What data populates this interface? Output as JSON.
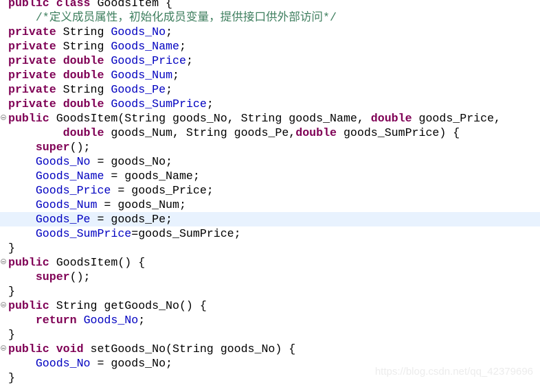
{
  "colors": {
    "keyword": "#7f0055",
    "field": "#0000c0",
    "comment": "#3f7f5f",
    "current_line": "#e8f2fe"
  },
  "highlighted_line": 15,
  "lines": [
    {
      "t": [
        [
          "k",
          "public"
        ],
        [
          "p",
          " "
        ],
        [
          "k",
          "class"
        ],
        [
          "p",
          " GoodsItem {"
        ]
      ]
    },
    {
      "t": [
        [
          "p",
          "    "
        ],
        [
          "c",
          "/*定义成员属性，初始化成员变量，提供接口供外部访问*/"
        ]
      ]
    },
    {
      "t": [
        [
          "k",
          "private"
        ],
        [
          "p",
          " String "
        ],
        [
          "f",
          "Goods_No"
        ],
        [
          "p",
          ";"
        ]
      ]
    },
    {
      "t": [
        [
          "k",
          "private"
        ],
        [
          "p",
          " String "
        ],
        [
          "f",
          "Goods_Name"
        ],
        [
          "p",
          ";"
        ]
      ]
    },
    {
      "t": [
        [
          "k",
          "private"
        ],
        [
          "p",
          " "
        ],
        [
          "k",
          "double"
        ],
        [
          "p",
          " "
        ],
        [
          "f",
          "Goods_Price"
        ],
        [
          "p",
          ";"
        ]
      ]
    },
    {
      "t": [
        [
          "k",
          "private"
        ],
        [
          "p",
          " "
        ],
        [
          "k",
          "double"
        ],
        [
          "p",
          " "
        ],
        [
          "f",
          "Goods_Num"
        ],
        [
          "p",
          ";"
        ]
      ]
    },
    {
      "t": [
        [
          "k",
          "private"
        ],
        [
          "p",
          " String "
        ],
        [
          "f",
          "Goods_Pe"
        ],
        [
          "p",
          ";"
        ]
      ]
    },
    {
      "t": [
        [
          "k",
          "private"
        ],
        [
          "p",
          " "
        ],
        [
          "k",
          "double"
        ],
        [
          "p",
          " "
        ],
        [
          "f",
          "Goods_SumPrice"
        ],
        [
          "p",
          ";"
        ]
      ]
    },
    {
      "fold": true,
      "t": [
        [
          "k",
          "public"
        ],
        [
          "p",
          " GoodsItem(String goods_No, String goods_Name, "
        ],
        [
          "k",
          "double"
        ],
        [
          "p",
          " goods_Price,"
        ]
      ]
    },
    {
      "t": [
        [
          "p",
          "        "
        ],
        [
          "k",
          "double"
        ],
        [
          "p",
          " goods_Num, String goods_Pe,"
        ],
        [
          "k",
          "double"
        ],
        [
          "p",
          " goods_SumPrice) {"
        ]
      ]
    },
    {
      "t": [
        [
          "p",
          "    "
        ],
        [
          "k",
          "super"
        ],
        [
          "p",
          "();"
        ]
      ]
    },
    {
      "t": [
        [
          "p",
          "    "
        ],
        [
          "f",
          "Goods_No"
        ],
        [
          "p",
          " = goods_No;"
        ]
      ]
    },
    {
      "t": [
        [
          "p",
          "    "
        ],
        [
          "f",
          "Goods_Name"
        ],
        [
          "p",
          " = goods_Name;"
        ]
      ]
    },
    {
      "t": [
        [
          "p",
          "    "
        ],
        [
          "f",
          "Goods_Price"
        ],
        [
          "p",
          " = goods_Price;"
        ]
      ]
    },
    {
      "t": [
        [
          "p",
          "    "
        ],
        [
          "f",
          "Goods_Num"
        ],
        [
          "p",
          " = goods_Num;"
        ]
      ]
    },
    {
      "t": [
        [
          "p",
          "    "
        ],
        [
          "f",
          "Goods_Pe"
        ],
        [
          "p",
          " = goods_Pe;"
        ]
      ]
    },
    {
      "t": [
        [
          "p",
          "    "
        ],
        [
          "f",
          "Goods_SumPrice"
        ],
        [
          "p",
          "=goods_SumPrice;"
        ]
      ]
    },
    {
      "t": [
        [
          "p",
          "}"
        ]
      ]
    },
    {
      "fold": true,
      "t": [
        [
          "k",
          "public"
        ],
        [
          "p",
          " GoodsItem() {"
        ]
      ]
    },
    {
      "t": [
        [
          "p",
          "    "
        ],
        [
          "k",
          "super"
        ],
        [
          "p",
          "();"
        ]
      ]
    },
    {
      "t": [
        [
          "p",
          "}"
        ]
      ]
    },
    {
      "fold": true,
      "t": [
        [
          "k",
          "public"
        ],
        [
          "p",
          " String getGoods_No() {"
        ]
      ]
    },
    {
      "t": [
        [
          "p",
          "    "
        ],
        [
          "k",
          "return"
        ],
        [
          "p",
          " "
        ],
        [
          "f",
          "Goods_No"
        ],
        [
          "p",
          ";"
        ]
      ]
    },
    {
      "t": [
        [
          "p",
          "}"
        ]
      ]
    },
    {
      "fold": true,
      "t": [
        [
          "k",
          "public"
        ],
        [
          "p",
          " "
        ],
        [
          "k",
          "void"
        ],
        [
          "p",
          " setGoods_No(String goods_No) {"
        ]
      ]
    },
    {
      "t": [
        [
          "p",
          "    "
        ],
        [
          "f",
          "Goods_No"
        ],
        [
          "p",
          " = goods_No;"
        ]
      ]
    },
    {
      "t": [
        [
          "p",
          "}"
        ]
      ]
    }
  ],
  "watermark": "https://blog.csdn.net/qq_42379696"
}
